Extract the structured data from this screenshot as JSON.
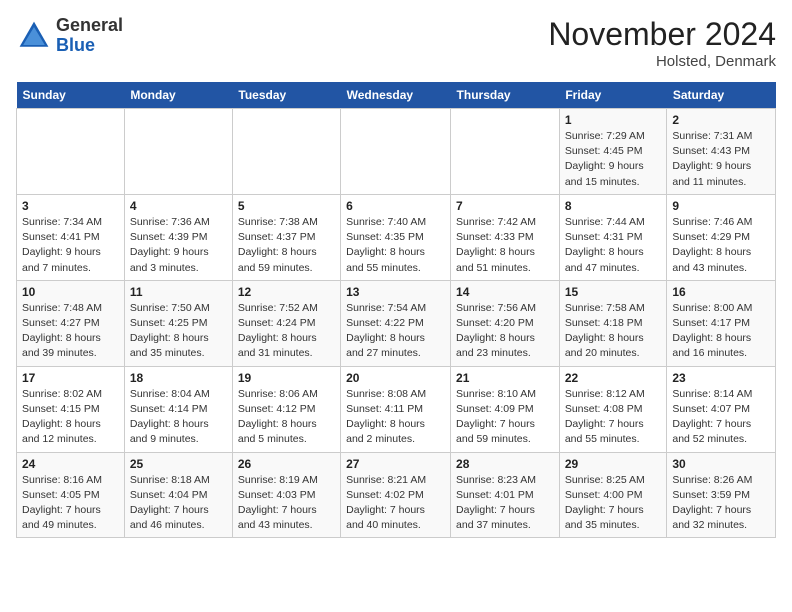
{
  "header": {
    "logo_general": "General",
    "logo_blue": "Blue",
    "month_title": "November 2024",
    "location": "Holsted, Denmark"
  },
  "weekdays": [
    "Sunday",
    "Monday",
    "Tuesday",
    "Wednesday",
    "Thursday",
    "Friday",
    "Saturday"
  ],
  "weeks": [
    [
      {
        "day": "",
        "info": ""
      },
      {
        "day": "",
        "info": ""
      },
      {
        "day": "",
        "info": ""
      },
      {
        "day": "",
        "info": ""
      },
      {
        "day": "",
        "info": ""
      },
      {
        "day": "1",
        "info": "Sunrise: 7:29 AM\nSunset: 4:45 PM\nDaylight: 9 hours and 15 minutes."
      },
      {
        "day": "2",
        "info": "Sunrise: 7:31 AM\nSunset: 4:43 PM\nDaylight: 9 hours and 11 minutes."
      }
    ],
    [
      {
        "day": "3",
        "info": "Sunrise: 7:34 AM\nSunset: 4:41 PM\nDaylight: 9 hours and 7 minutes."
      },
      {
        "day": "4",
        "info": "Sunrise: 7:36 AM\nSunset: 4:39 PM\nDaylight: 9 hours and 3 minutes."
      },
      {
        "day": "5",
        "info": "Sunrise: 7:38 AM\nSunset: 4:37 PM\nDaylight: 8 hours and 59 minutes."
      },
      {
        "day": "6",
        "info": "Sunrise: 7:40 AM\nSunset: 4:35 PM\nDaylight: 8 hours and 55 minutes."
      },
      {
        "day": "7",
        "info": "Sunrise: 7:42 AM\nSunset: 4:33 PM\nDaylight: 8 hours and 51 minutes."
      },
      {
        "day": "8",
        "info": "Sunrise: 7:44 AM\nSunset: 4:31 PM\nDaylight: 8 hours and 47 minutes."
      },
      {
        "day": "9",
        "info": "Sunrise: 7:46 AM\nSunset: 4:29 PM\nDaylight: 8 hours and 43 minutes."
      }
    ],
    [
      {
        "day": "10",
        "info": "Sunrise: 7:48 AM\nSunset: 4:27 PM\nDaylight: 8 hours and 39 minutes."
      },
      {
        "day": "11",
        "info": "Sunrise: 7:50 AM\nSunset: 4:25 PM\nDaylight: 8 hours and 35 minutes."
      },
      {
        "day": "12",
        "info": "Sunrise: 7:52 AM\nSunset: 4:24 PM\nDaylight: 8 hours and 31 minutes."
      },
      {
        "day": "13",
        "info": "Sunrise: 7:54 AM\nSunset: 4:22 PM\nDaylight: 8 hours and 27 minutes."
      },
      {
        "day": "14",
        "info": "Sunrise: 7:56 AM\nSunset: 4:20 PM\nDaylight: 8 hours and 23 minutes."
      },
      {
        "day": "15",
        "info": "Sunrise: 7:58 AM\nSunset: 4:18 PM\nDaylight: 8 hours and 20 minutes."
      },
      {
        "day": "16",
        "info": "Sunrise: 8:00 AM\nSunset: 4:17 PM\nDaylight: 8 hours and 16 minutes."
      }
    ],
    [
      {
        "day": "17",
        "info": "Sunrise: 8:02 AM\nSunset: 4:15 PM\nDaylight: 8 hours and 12 minutes."
      },
      {
        "day": "18",
        "info": "Sunrise: 8:04 AM\nSunset: 4:14 PM\nDaylight: 8 hours and 9 minutes."
      },
      {
        "day": "19",
        "info": "Sunrise: 8:06 AM\nSunset: 4:12 PM\nDaylight: 8 hours and 5 minutes."
      },
      {
        "day": "20",
        "info": "Sunrise: 8:08 AM\nSunset: 4:11 PM\nDaylight: 8 hours and 2 minutes."
      },
      {
        "day": "21",
        "info": "Sunrise: 8:10 AM\nSunset: 4:09 PM\nDaylight: 7 hours and 59 minutes."
      },
      {
        "day": "22",
        "info": "Sunrise: 8:12 AM\nSunset: 4:08 PM\nDaylight: 7 hours and 55 minutes."
      },
      {
        "day": "23",
        "info": "Sunrise: 8:14 AM\nSunset: 4:07 PM\nDaylight: 7 hours and 52 minutes."
      }
    ],
    [
      {
        "day": "24",
        "info": "Sunrise: 8:16 AM\nSunset: 4:05 PM\nDaylight: 7 hours and 49 minutes."
      },
      {
        "day": "25",
        "info": "Sunrise: 8:18 AM\nSunset: 4:04 PM\nDaylight: 7 hours and 46 minutes."
      },
      {
        "day": "26",
        "info": "Sunrise: 8:19 AM\nSunset: 4:03 PM\nDaylight: 7 hours and 43 minutes."
      },
      {
        "day": "27",
        "info": "Sunrise: 8:21 AM\nSunset: 4:02 PM\nDaylight: 7 hours and 40 minutes."
      },
      {
        "day": "28",
        "info": "Sunrise: 8:23 AM\nSunset: 4:01 PM\nDaylight: 7 hours and 37 minutes."
      },
      {
        "day": "29",
        "info": "Sunrise: 8:25 AM\nSunset: 4:00 PM\nDaylight: 7 hours and 35 minutes."
      },
      {
        "day": "30",
        "info": "Sunrise: 8:26 AM\nSunset: 3:59 PM\nDaylight: 7 hours and 32 minutes."
      }
    ]
  ]
}
